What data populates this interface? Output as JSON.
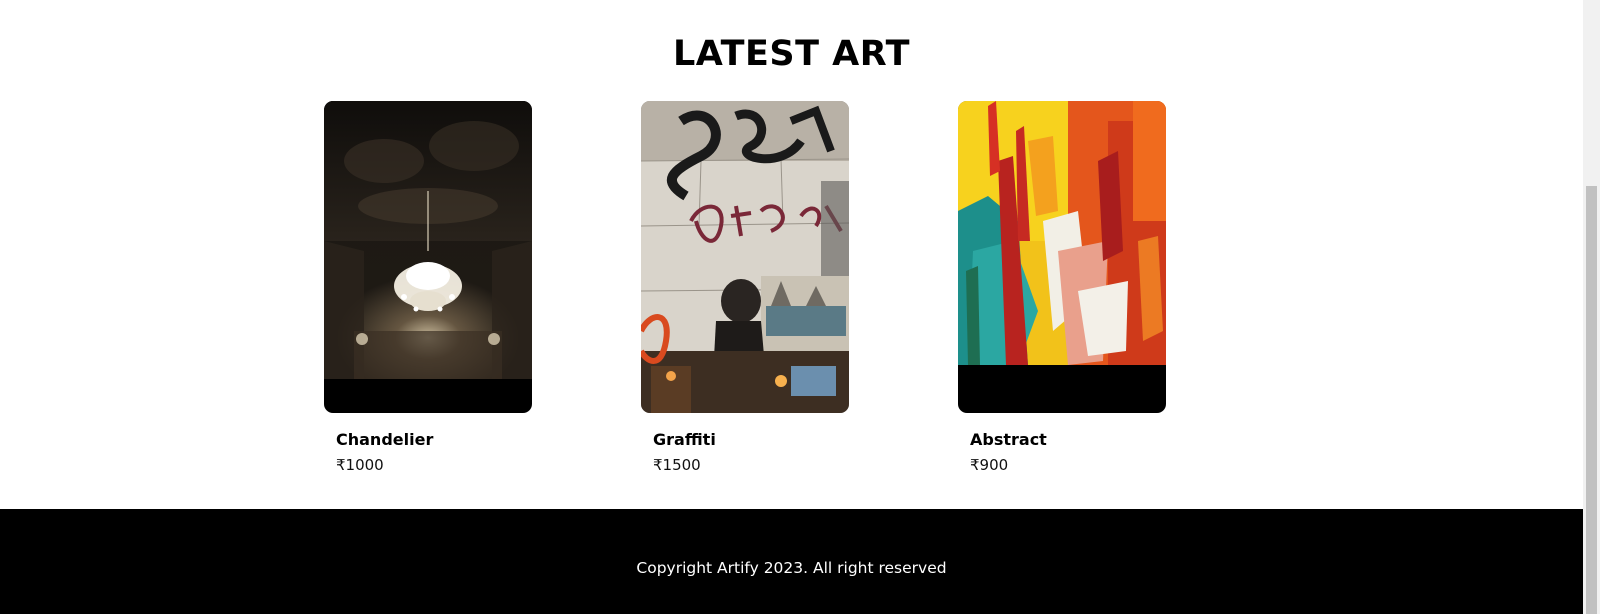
{
  "section": {
    "title": "LATEST ART"
  },
  "artworks": [
    {
      "name": "Chandelier",
      "price": "₹1000"
    },
    {
      "name": "Graffiti",
      "price": "₹1500"
    },
    {
      "name": "Abstract",
      "price": "₹900"
    }
  ],
  "footer": {
    "copyright": "Copyright Artify 2023. All right reserved"
  }
}
